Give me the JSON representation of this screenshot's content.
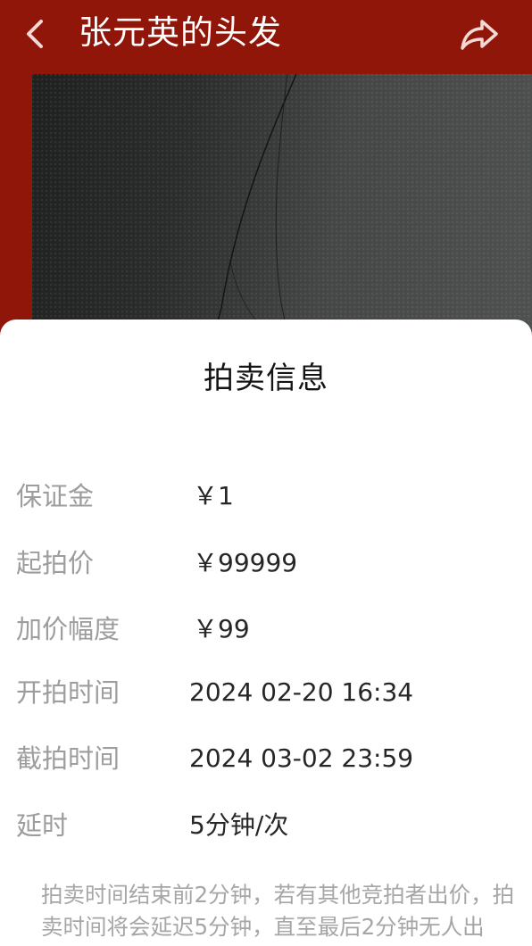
{
  "header": {
    "title": "张元英的头发",
    "back_icon": "chevron-left-icon",
    "share_icon": "share-arrow-icon",
    "background_color": "#8f1608"
  },
  "photo": {
    "description_icon": "hair-on-dark-surface-photo"
  },
  "auction_info": {
    "title": "拍卖信息",
    "rows": [
      {
        "label": "保证金",
        "value": "￥1"
      },
      {
        "label": "起拍价",
        "value": "￥99999"
      },
      {
        "label": "加价幅度",
        "value": "￥99"
      },
      {
        "label": "开拍时间",
        "value": "2024 02-20 16:34"
      },
      {
        "label": "截拍时间",
        "value": "2024 03-02 23:59"
      },
      {
        "label": "延时",
        "value": "5分钟/次"
      }
    ],
    "note_lines": [
      "拍卖时间结束前2分钟，若有其他竞拍者出价，拍",
      "卖时间将会延迟5分钟，直至最后2分钟无人出"
    ]
  }
}
